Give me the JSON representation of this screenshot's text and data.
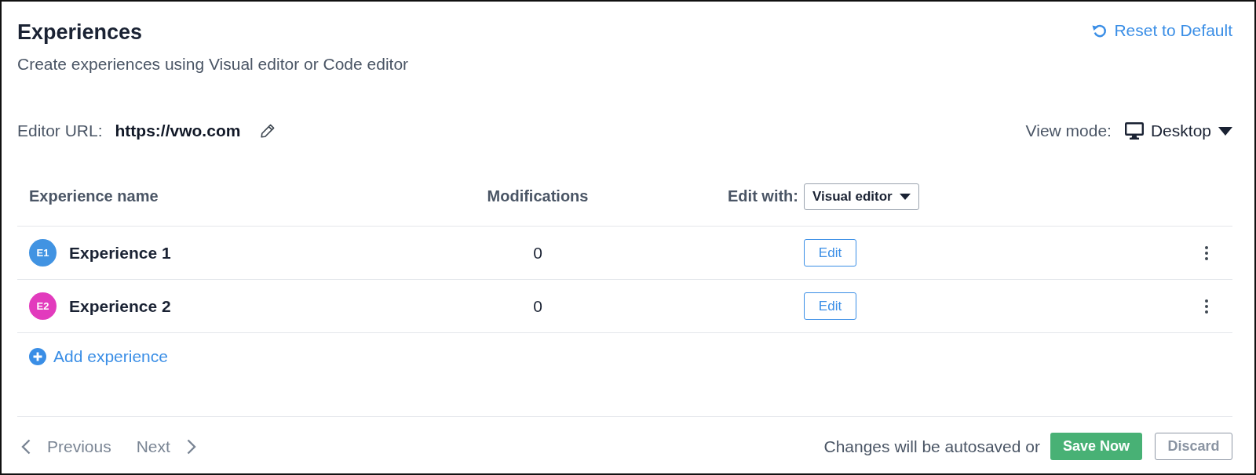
{
  "header": {
    "title": "Experiences",
    "subtitle": "Create experiences using Visual editor or Code editor",
    "reset_link": "Reset to Default"
  },
  "editor_url": {
    "label": "Editor URL:",
    "value": "https://vwo.com"
  },
  "view_mode": {
    "label": "View mode:",
    "value": "Desktop"
  },
  "table": {
    "columns": [
      "Experience name",
      "Modifications"
    ],
    "edit_with": {
      "label": "Edit with:",
      "value": "Visual editor"
    },
    "rows": [
      {
        "badge": "E1",
        "color": "#4193e2",
        "name": "Experience 1",
        "modifications": "0",
        "action": "Edit"
      },
      {
        "badge": "E2",
        "color": "#e23bbd",
        "name": "Experience 2",
        "modifications": "0",
        "action": "Edit"
      }
    ]
  },
  "add_button": "Add experience",
  "footer": {
    "previous": "Previous",
    "next": "Next",
    "note": "Changes will be autosaved or",
    "save_button": "Save Now",
    "discard_button": "Discard"
  }
}
